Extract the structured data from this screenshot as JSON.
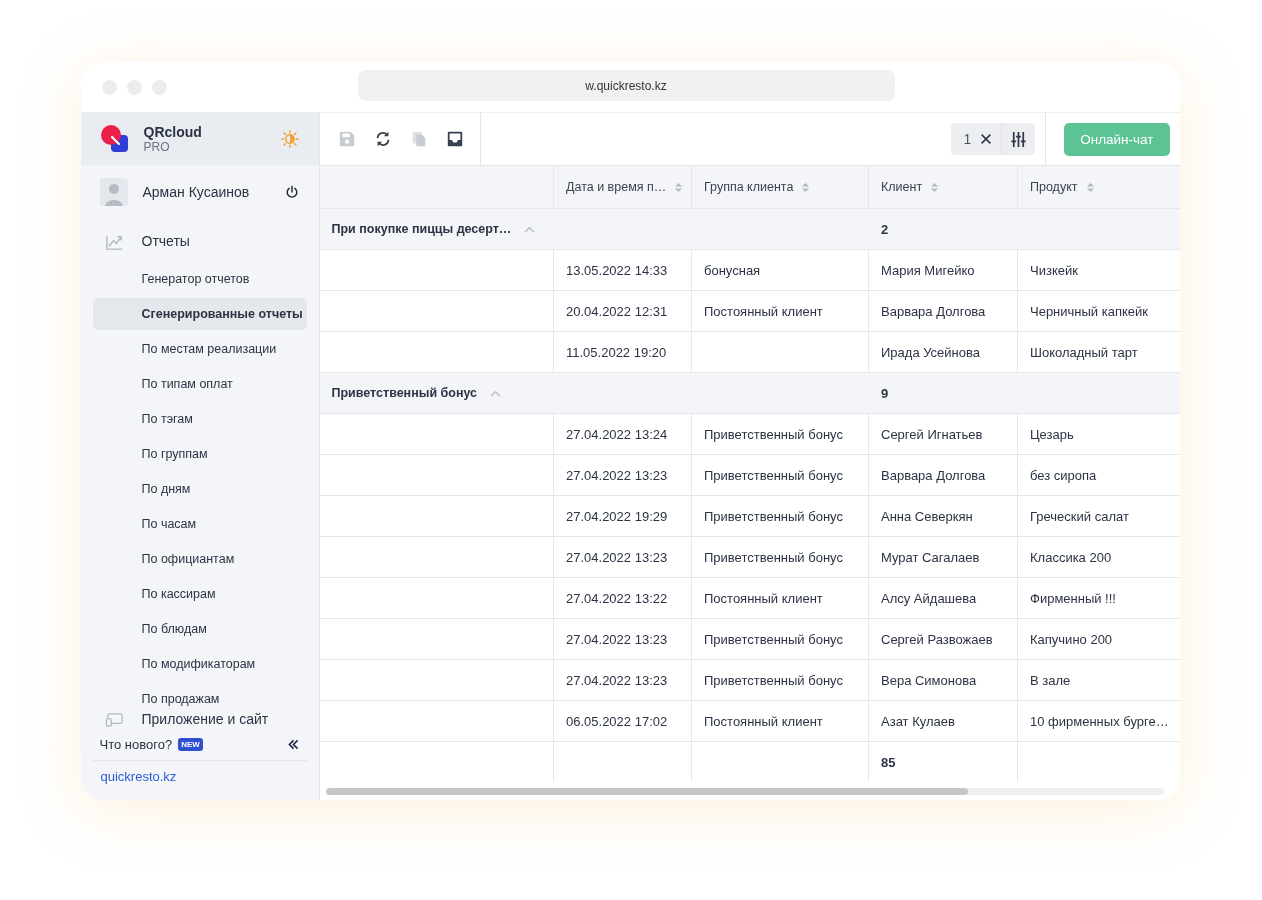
{
  "browser": {
    "url": "w.quickresto.kz"
  },
  "sidebar": {
    "brand": {
      "name": "QRcloud",
      "plan": "PRO"
    },
    "user": {
      "name": "Арман Кусаинов"
    },
    "section": {
      "label": "Отчеты"
    },
    "items": [
      {
        "label": "Генератор отчетов",
        "selected": false
      },
      {
        "label": "Сгенерированные отчеты",
        "selected": true
      },
      {
        "label": "По местам реализации",
        "selected": false
      },
      {
        "label": "По типам оплат",
        "selected": false
      },
      {
        "label": "По тэгам",
        "selected": false
      },
      {
        "label": "По группам",
        "selected": false
      },
      {
        "label": "По дням",
        "selected": false
      },
      {
        "label": "По часам",
        "selected": false
      },
      {
        "label": "По официантам",
        "selected": false
      },
      {
        "label": "По кассирам",
        "selected": false
      },
      {
        "label": "По блюдам",
        "selected": false
      },
      {
        "label": "По модификаторам",
        "selected": false
      },
      {
        "label": "По продажам",
        "selected": false
      }
    ],
    "app_section": {
      "label": "Приложение и сайт"
    },
    "whats_new": {
      "label": "Что нового?",
      "badge": "NEW"
    },
    "footer_link": "quickresto.kz"
  },
  "toolbar": {
    "actions": [
      {
        "kind": "save",
        "disabled": true
      },
      {
        "kind": "refresh",
        "disabled": false
      },
      {
        "kind": "copy",
        "disabled": true
      },
      {
        "kind": "inbox",
        "disabled": false
      }
    ],
    "filter_count": "1",
    "chat_button": "Онлайн-чат"
  },
  "table": {
    "columns": [
      {
        "label": "Дата и время п…"
      },
      {
        "label": "Группа клиента"
      },
      {
        "label": "Клиент"
      },
      {
        "label": "Продукт"
      }
    ],
    "groups": [
      {
        "title": "При покупке пиццы десерт…",
        "expanded": true,
        "count": "2",
        "rows": [
          {
            "date": "13.05.2022 14:33",
            "group": "бонусная",
            "client": "Мария Мигейко",
            "product": "Чизкейк"
          },
          {
            "date": "20.04.2022 12:31",
            "group": "Постоянный клиент",
            "client": "Варвара Долгова",
            "product": "Черничный капкейк"
          },
          {
            "date": "11.05.2022 19:20",
            "group": "",
            "client": "Ирада Усейнова",
            "product": "Шоколадный тарт"
          }
        ]
      },
      {
        "title": "Приветственный бонус",
        "expanded": true,
        "count": "9",
        "rows": [
          {
            "date": "27.04.2022 13:24",
            "group": "Приветственный бонус",
            "client": "Сергей Игнатьев",
            "product": "Цезарь"
          },
          {
            "date": "27.04.2022 13:23",
            "group": "Приветственный бонус",
            "client": "Варвара Долгова",
            "product": "без сиропа"
          },
          {
            "date": "27.04.2022 19:29",
            "group": "Приветственный бонус",
            "client": "Анна Северкян",
            "product": "Греческий салат"
          },
          {
            "date": "27.04.2022 13:23",
            "group": "Приветственный бонус",
            "client": "Мурат Сагалаев",
            "product": "Классика 200"
          },
          {
            "date": "27.04.2022 13:22",
            "group": "Постоянный клиент",
            "client": "Алсу Айдашева",
            "product": "Фирменный !!!"
          },
          {
            "date": "27.04.2022 13:23",
            "group": "Приветственный бонус",
            "client": "Сергей Развожаев",
            "product": "Капучино 200"
          },
          {
            "date": "27.04.2022 13:23",
            "group": "Приветственный бонус",
            "client": "Вера Симонова",
            "product": "В зале"
          },
          {
            "date": "06.05.2022 17:02",
            "group": "Постоянный клиент",
            "client": "Азат Кулаев",
            "product": "10 фирменных бурге…"
          }
        ]
      }
    ],
    "total": "85"
  }
}
